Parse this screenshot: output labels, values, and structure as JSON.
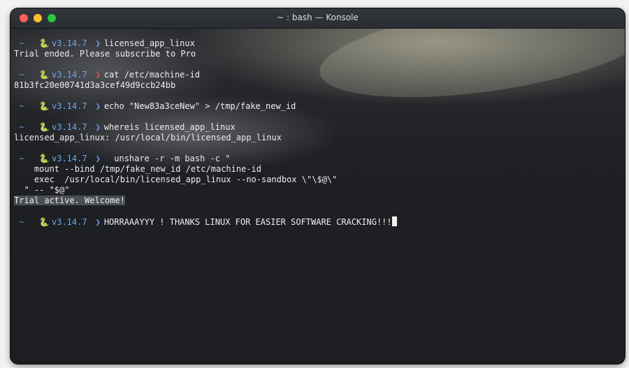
{
  "window": {
    "title": "~ : bash — Konsole"
  },
  "prompt": {
    "dir": "~",
    "snake": "🐍",
    "version": "v3.14.7",
    "arrow": "❯"
  },
  "terminal": {
    "lines": [
      {
        "type": "prompt",
        "arrow": "ok",
        "command": "licensed_app_linux"
      },
      {
        "type": "output",
        "text": "Trial ended. Please subscribe to Pro"
      },
      {
        "type": "blank"
      },
      {
        "type": "prompt",
        "arrow": "err",
        "command": "cat /etc/machine-id"
      },
      {
        "type": "output",
        "text": "81b3fc20e00741d3a3cef49d9ccb24bb"
      },
      {
        "type": "blank"
      },
      {
        "type": "prompt",
        "arrow": "ok",
        "command": "echo \"New83a3ceNew\" > /tmp/fake_new_id"
      },
      {
        "type": "blank"
      },
      {
        "type": "prompt",
        "arrow": "ok",
        "command": "whereis licensed_app_linux"
      },
      {
        "type": "output",
        "text": "licensed_app_linux: /usr/local/bin/licensed_app_linux"
      },
      {
        "type": "blank"
      },
      {
        "type": "prompt",
        "arrow": "ok",
        "command": "  unshare -r -m bash -c \""
      },
      {
        "type": "output",
        "text": "    mount --bind /tmp/fake_new_id /etc/machine-id"
      },
      {
        "type": "output",
        "text": "    exec  /usr/local/bin/licensed_app_linux --no-sandbox \\\"\\$@\\\""
      },
      {
        "type": "output",
        "text": "  \" -- \"$@\""
      },
      {
        "type": "highlight",
        "text": "Trial active. Welcome!"
      },
      {
        "type": "blank"
      },
      {
        "type": "prompt",
        "arrow": "ok",
        "command": "HORRAAAYYY ! THANKS LINUX FOR EASIER SOFTWARE CRACKING!!!",
        "cursor": true
      }
    ]
  },
  "colors": {
    "prompt_dir": "#5aa0e8",
    "snake": "#d4c445",
    "version": "#6aa8f0",
    "arrow_ok": "#6ea0ef",
    "arrow_err": "#e05555",
    "text": "#e8e8e8",
    "highlight_bg": "#4b4e55"
  }
}
